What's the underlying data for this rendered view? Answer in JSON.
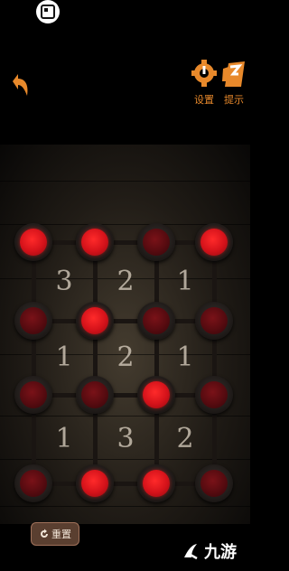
{
  "header": {
    "settings_label": "设置",
    "hint_label": "提示",
    "accent_color": "#e8892b"
  },
  "board": {
    "rows": [
      [
        true,
        true,
        false,
        true
      ],
      [
        false,
        true,
        false,
        false
      ],
      [
        false,
        false,
        true,
        false
      ],
      [
        false,
        true,
        true,
        false
      ]
    ],
    "clues": [
      [
        "3",
        "2",
        "1"
      ],
      [
        "1",
        "2",
        "1"
      ],
      [
        "1",
        "3",
        "2"
      ]
    ]
  },
  "footer": {
    "reset_label": "重置",
    "watermark_text": "九游"
  }
}
